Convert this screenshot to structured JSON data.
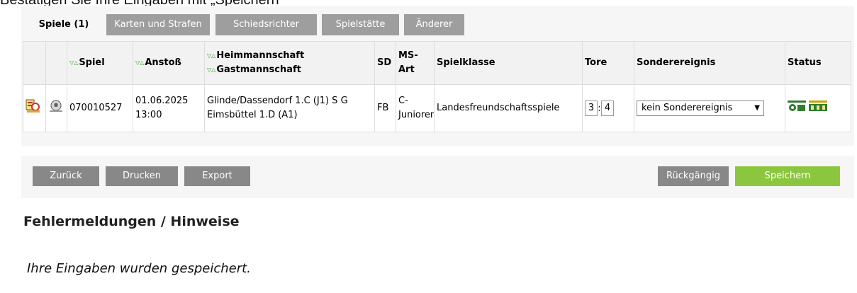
{
  "caption": "Bestätigen Sie Ihre Eingaben mit „Speichern“",
  "tabs": [
    {
      "label": "Spiele (1)",
      "active": true
    },
    {
      "label": "Karten und Strafen",
      "active": false
    },
    {
      "label": "Schiedsrichter",
      "active": false
    },
    {
      "label": "Spielstätte",
      "active": false
    },
    {
      "label": "Änderer",
      "active": false
    }
  ],
  "columns": {
    "spiel": "Spiel",
    "anstoss": "Anstoß",
    "heim": "Heimmannschaft",
    "gast": "Gastmannschaft",
    "sd": "SD",
    "ms_art": "MS-Art",
    "spielklasse": "Spielklasse",
    "tore": "Tore",
    "sonderereignis": "Sonderereignis",
    "status": "Status"
  },
  "game": {
    "nummer": "070010527",
    "datum": "01.06.2025",
    "zeit": "13:00",
    "heim": "Glinde/Dassendorf 1.C (J1) S G",
    "gast": "Eimsbüttel 1.D (A1)",
    "sd": "FB",
    "ms_art": "C-Junioren",
    "spielklasse": "Landesfreundschaftsspiele",
    "tore_heim": "3",
    "tore_sep": ":",
    "tore_gast": "4",
    "sonderereignis": "kein Sonderereignis"
  },
  "buttons": {
    "zurueck": "Zurück",
    "drucken": "Drucken",
    "export": "Export",
    "rueckgaengig": "Rückgängig",
    "speichern": "Speichern"
  },
  "messages": {
    "heading": "Fehlermeldungen / Hinweise",
    "text": "Ihre Eingaben wurden gespeichert."
  },
  "colors": {
    "tab_inactive": "#9e9e9e",
    "button_grey": "#888888",
    "button_green": "#8cc63f",
    "sort_arrow": "#3a9f2d"
  }
}
